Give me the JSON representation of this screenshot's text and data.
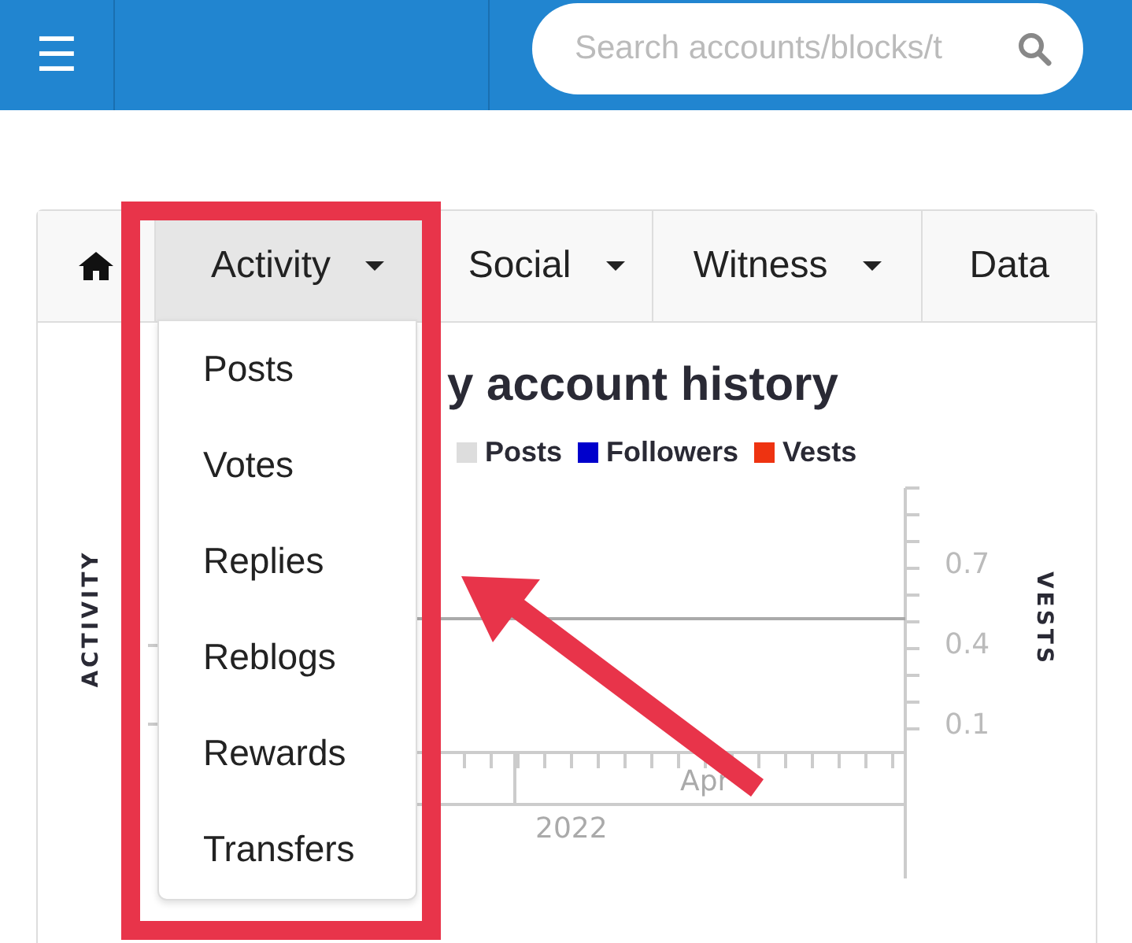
{
  "header": {
    "menu_icon": "☰",
    "search": {
      "placeholder": "Search accounts/blocks/t"
    }
  },
  "tabs": [
    {
      "kind": "home",
      "selected": false
    },
    {
      "kind": "dropdown",
      "label": "Activity",
      "selected": true
    },
    {
      "kind": "dropdown",
      "label": "Social",
      "selected": false
    },
    {
      "kind": "dropdown",
      "label": "Witness",
      "selected": false
    },
    {
      "kind": "plain",
      "label": "Data",
      "selected": false
    }
  ],
  "dropdown": {
    "items": [
      "Posts",
      "Votes",
      "Replies",
      "Reblogs",
      "Rewards",
      "Transfers"
    ]
  },
  "chart": {
    "title": "y account history",
    "legend": [
      {
        "label": "Posts",
        "color": "#dddddd"
      },
      {
        "label": "Followers",
        "color": "#0000cc"
      },
      {
        "label": "Vests",
        "color": "#ee3311"
      }
    ],
    "left_axis_label": "ACTIVITY",
    "right_axis_label": "VESTS",
    "right_ticks": [
      "0.7",
      "0.4",
      "0.1"
    ],
    "x_labels": [
      "Apr",
      "2022"
    ]
  },
  "annotations": {
    "highlight_box": true,
    "arrow": true
  }
}
